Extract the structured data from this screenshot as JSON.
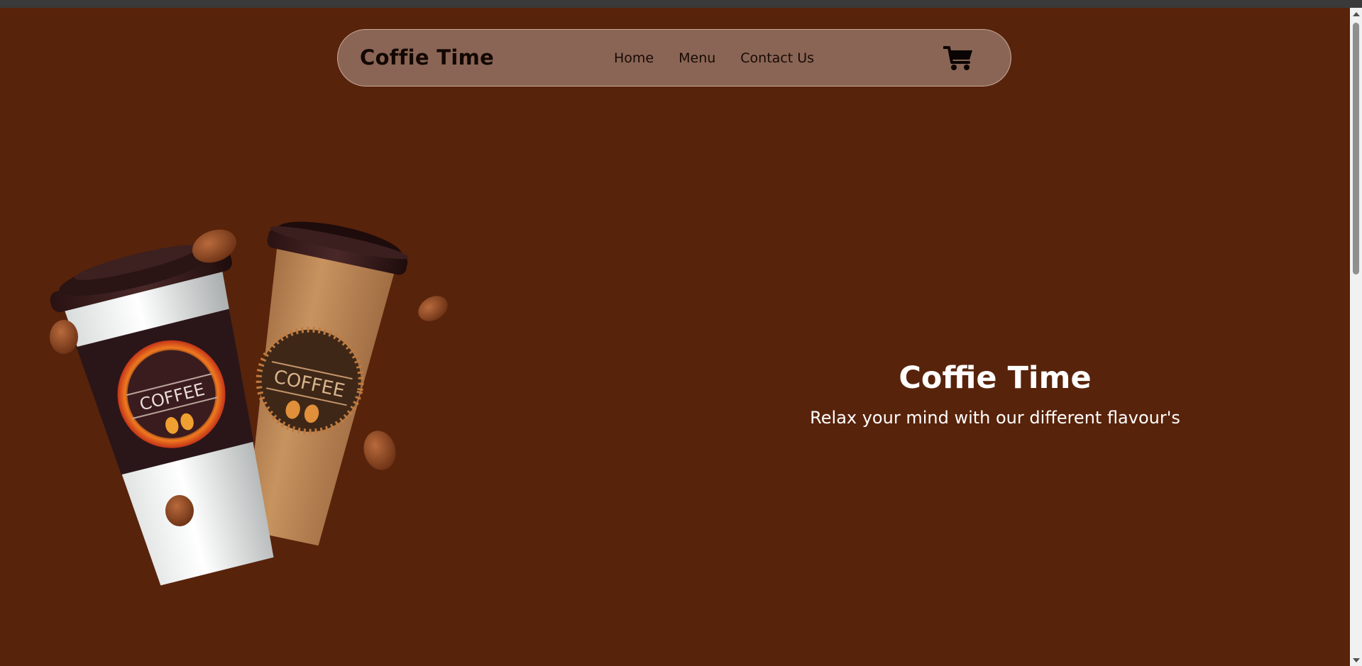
{
  "header": {
    "brand": "Coffie Time",
    "nav": {
      "home": "Home",
      "menu": "Menu",
      "contact": "Contact Us"
    },
    "cart_icon": "shopping-cart-icon"
  },
  "hero": {
    "image_label": "coffee-cups-image",
    "cup_text": "COFFEE",
    "title": "Coffie Time",
    "subtitle": "Relax your mind with our different flavour's"
  },
  "colors": {
    "background": "#58230b",
    "navbar": "#8a6555",
    "text_light": "#ffffff",
    "text_dark": "#120702"
  }
}
